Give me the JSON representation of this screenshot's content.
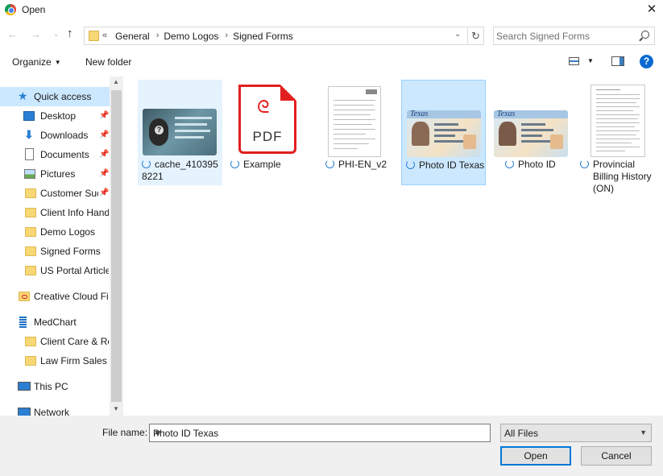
{
  "window": {
    "title": "Open",
    "close": "✕"
  },
  "nav": {
    "back": "←",
    "forward": "→",
    "history": "⌄",
    "up": "↑",
    "crumbs_prefix": "«",
    "crumbs": [
      "General",
      "Demo Logos",
      "Signed Forms"
    ],
    "crumb_sep": "›",
    "refresh": "↻",
    "search_placeholder": "Search Signed Forms"
  },
  "toolbar": {
    "organize": "Organize",
    "new_folder": "New folder",
    "help": "?"
  },
  "sidebar": {
    "items": [
      {
        "label": "Quick access",
        "icon": "star-icon",
        "pinned": false,
        "selected": true
      },
      {
        "label": "Desktop",
        "icon": "desktop-icon",
        "pinned": true
      },
      {
        "label": "Downloads",
        "icon": "download-icon",
        "pinned": true
      },
      {
        "label": "Documents",
        "icon": "documents-icon",
        "pinned": true
      },
      {
        "label": "Pictures",
        "icon": "pictures-icon",
        "pinned": true
      },
      {
        "label": "Customer Succ",
        "icon": "folder-icon",
        "pinned": true
      },
      {
        "label": "Client Info Hand",
        "icon": "folder-icon",
        "pinned": false
      },
      {
        "label": "Demo Logos",
        "icon": "folder-icon",
        "pinned": false
      },
      {
        "label": "Signed Forms",
        "icon": "folder-icon",
        "pinned": false
      },
      {
        "label": "US Portal Article",
        "icon": "folder-icon",
        "pinned": false
      },
      {
        "label": "Creative Cloud Fil",
        "icon": "creative-cloud-icon",
        "pinned": false
      },
      {
        "label": "MedChart",
        "icon": "building-icon",
        "pinned": false
      },
      {
        "label": "Client Care & Re",
        "icon": "folder-icon",
        "pinned": false
      },
      {
        "label": "Law Firm Sales -",
        "icon": "folder-icon",
        "pinned": false
      },
      {
        "label": "This PC",
        "icon": "pc-icon",
        "pinned": false
      },
      {
        "label": "Network",
        "icon": "network-icon",
        "pinned": false
      }
    ],
    "pin_glyph": "📌"
  },
  "files": [
    {
      "name": "cache_4103958221",
      "state": "highlight"
    },
    {
      "name": "Example",
      "state": "none",
      "pdf_label": "PDF"
    },
    {
      "name": "PHI-EN_v2",
      "state": "none"
    },
    {
      "name": "Photo ID Texas",
      "state": "selected"
    },
    {
      "name": "Photo ID",
      "state": "none"
    },
    {
      "name": "Provincial Billing History (ON)",
      "state": "none"
    }
  ],
  "bottom": {
    "file_name_label": "File name:",
    "file_name_value": "Photo ID Texas",
    "filter_value": "All Files",
    "open_label": "Open",
    "cancel_label": "Cancel"
  },
  "colors": {
    "selection": "#cce8ff",
    "accent": "#0078d7",
    "pdf_red": "#e21f1f",
    "folder": "#f8d775"
  }
}
